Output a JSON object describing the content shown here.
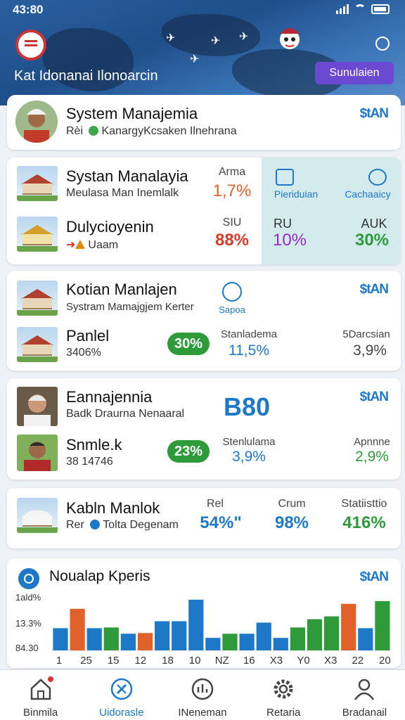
{
  "status": {
    "time": "43:80"
  },
  "header": {
    "title": "Kat Idonanai Ilonoarcin",
    "cta_label": "Sunulaien"
  },
  "profile_card": {
    "name": "System Manajemia",
    "sub_prefix": "Rèi",
    "sub_text": "KanargyKcsaken Ilnehrana",
    "tag": "$tAN"
  },
  "card2": {
    "row1": {
      "title": "Systan Manalayia",
      "sub": "Meulasa Man Inemlalk",
      "metric_label": "Arma",
      "metric_value": "1,7%"
    },
    "row2": {
      "title": "Dulycioyenin",
      "sub": "Uaam",
      "metric_label": "SIU",
      "metric_value": "88%"
    },
    "panel": {
      "left_label": "Pieriduian",
      "right_label": "Cachaaicy",
      "left_metric_label": "RU",
      "left_metric_value": "10%",
      "right_metric_label": "AUK",
      "right_metric_value": "30%"
    }
  },
  "card3": {
    "row1": {
      "title": "Kotian Manlajen",
      "sub": "Systram Mamajgjem Kerter",
      "icon_label": "Sapoa",
      "tag": "$tAN"
    },
    "row2": {
      "title": "Panlel",
      "sub": "3406%",
      "pill": "30%",
      "m1_label": "Stanladema",
      "m1_value": "11,5%",
      "m2_label": "5Darcsian",
      "m2_value": "3,9%"
    }
  },
  "card4": {
    "row1": {
      "title": "Eannajennia",
      "sub": "Badk Draurna Nenaaral",
      "big_value": "B80",
      "tag": "$tAN"
    },
    "row2": {
      "title": "Snmle.k",
      "sub": "38 14746",
      "pill": "23%",
      "m1_label": "Stenlulama",
      "m1_value": "3,9%",
      "m2_label": "Apnnne",
      "m2_value": "2,9%"
    }
  },
  "card5": {
    "title": "Kabln Manlok",
    "sub_prefix": "Rer",
    "sub_text": "Tolta Degenam",
    "m1_label": "Rel",
    "m1_value": "54%\"",
    "m2_label": "Crum",
    "m2_value": "98%",
    "m3_label": "Statiisttio",
    "m3_value": "416%"
  },
  "chart_card": {
    "title": "Noualap Kperis",
    "tag": "$tAN"
  },
  "colors": {
    "accent": "#1d78c8",
    "orange": "#e0622a",
    "green": "#2e9a3a",
    "purple": "#6b4ad1",
    "red": "#d83a2a"
  },
  "chart_data": {
    "type": "bar",
    "ytick_labels": [
      "1ald%",
      "13.3%",
      "84.30"
    ],
    "categories": [
      "1",
      "25",
      "15",
      "12",
      "18",
      "10",
      "NZ",
      "16",
      "X3",
      "Y0",
      "X3",
      "22",
      "20"
    ],
    "bars": [
      {
        "v": 32,
        "c": "blue"
      },
      {
        "v": 60,
        "c": "orange"
      },
      {
        "v": 32,
        "c": "blue"
      },
      {
        "v": 33,
        "c": "green"
      },
      {
        "v": 24,
        "c": "blue"
      },
      {
        "v": 25,
        "c": "orange"
      },
      {
        "v": 42,
        "c": "blue"
      },
      {
        "v": 42,
        "c": "blue"
      },
      {
        "v": 73,
        "c": "blue"
      },
      {
        "v": 18,
        "c": "blue"
      },
      {
        "v": 24,
        "c": "green"
      },
      {
        "v": 24,
        "c": "blue"
      },
      {
        "v": 40,
        "c": "blue"
      },
      {
        "v": 18,
        "c": "blue"
      },
      {
        "v": 33,
        "c": "green"
      },
      {
        "v": 45,
        "c": "green"
      },
      {
        "v": 49,
        "c": "green"
      },
      {
        "v": 67,
        "c": "orange"
      },
      {
        "v": 32,
        "c": "blue"
      },
      {
        "v": 71,
        "c": "green"
      }
    ],
    "ylim": [
      0,
      80
    ]
  },
  "tabs": [
    {
      "label": "Binmila",
      "icon": "home-icon"
    },
    {
      "label": "Uidorasle",
      "icon": "compass-icon"
    },
    {
      "label": "INeneman",
      "icon": "stats-icon"
    },
    {
      "label": "Retaria",
      "icon": "gear-icon"
    },
    {
      "label": "Bradanail",
      "icon": "user-icon"
    }
  ]
}
